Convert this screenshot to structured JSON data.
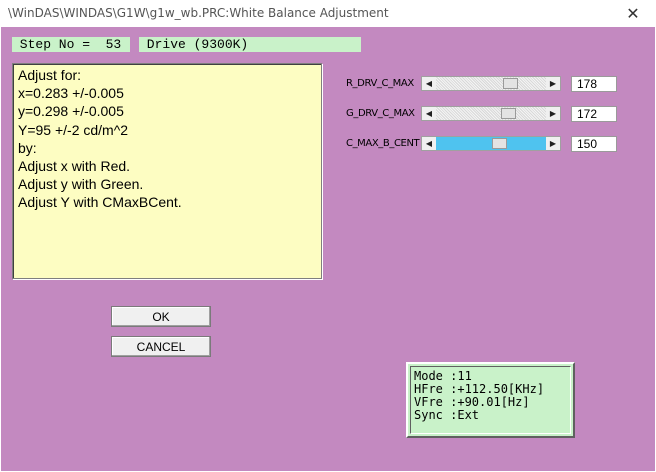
{
  "window": {
    "title": "\\WinDAS\\WINDAS\\G1W\\g1w_wb.PRC:White Balance Adjustment",
    "close_glyph": "✕"
  },
  "step": {
    "text": " Step No =  53"
  },
  "drive": {
    "text": " Drive (9300K)"
  },
  "instructions": [
    "Adjust for:",
    "x=0.283 +/-0.005",
    "y=0.298 +/-0.005",
    "Y=95 +/-2 cd/m^2",
    "by:",
    "Adjust x with Red.",
    "Adjust y with Green.",
    "Adjust Y with CMaxBCent."
  ],
  "sliders": [
    {
      "label": "R_DRV_C_MAX",
      "value": "178",
      "level": 0.7,
      "active": false
    },
    {
      "label": "G_DRV_C_MAX",
      "value": "172",
      "level": 0.68,
      "active": false
    },
    {
      "label": "C_MAX_B_CENT",
      "value": "150",
      "level": 0.59,
      "active": true
    }
  ],
  "scroll_arrows": {
    "left": "◀",
    "right": "▶"
  },
  "buttons": {
    "ok": "OK",
    "cancel": "CANCEL"
  },
  "info": [
    "Mode :11",
    "HFre :+112.50[KHz]",
    "VFre :+90.01[Hz]",
    "Sync :Ext"
  ],
  "colors": {
    "background": "#c389c0",
    "instructions_bg": "#fdfdc2",
    "status_bg": "#c9f2c9",
    "active_track": "#4fc3ef"
  }
}
